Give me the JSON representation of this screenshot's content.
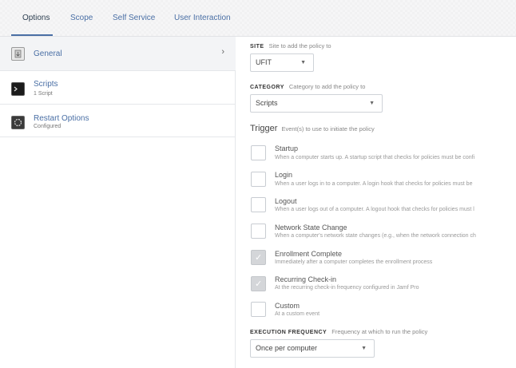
{
  "tabs": [
    {
      "label": "Options"
    },
    {
      "label": "Scope"
    },
    {
      "label": "Self Service"
    },
    {
      "label": "User Interaction"
    }
  ],
  "sidebar": {
    "items": [
      {
        "title": "General",
        "subtitle": "",
        "icon": "general-icon"
      },
      {
        "title": "Scripts",
        "subtitle": "1 Script",
        "icon": "terminal-icon"
      },
      {
        "title": "Restart Options",
        "subtitle": "Configured",
        "icon": "restart-icon"
      }
    ]
  },
  "site": {
    "label": "SITE",
    "hint": "Site to add the policy to",
    "value": "UFIT"
  },
  "category": {
    "label": "CATEGORY",
    "hint": "Category to add the policy to",
    "value": "Scripts"
  },
  "trigger": {
    "title": "Trigger",
    "hint": "Event(s) to use to initiate the policy",
    "options": [
      {
        "label": "Startup",
        "desc": "When a computer starts up. A startup script that checks for policies must be confi",
        "checked": false
      },
      {
        "label": "Login",
        "desc": "When a user logs in to a computer. A login hook that checks for policies must be",
        "checked": false
      },
      {
        "label": "Logout",
        "desc": "When a user logs out of a computer. A logout hook that checks for policies must l",
        "checked": false
      },
      {
        "label": "Network State Change",
        "desc": "When a computer's network state changes (e.g., when the network connection ch",
        "checked": false
      },
      {
        "label": "Enrollment Complete",
        "desc": "Immediately after a computer completes the enrollment process",
        "checked": true
      },
      {
        "label": "Recurring Check-in",
        "desc": "At the recurring check-in frequency configured in Jamf Pro",
        "checked": true
      },
      {
        "label": "Custom",
        "desc": "At a custom event",
        "checked": false
      }
    ]
  },
  "execution": {
    "label": "EXECUTION FREQUENCY",
    "hint": "Frequency at which to run the policy",
    "value": "Once per computer"
  },
  "colors": {
    "accent": "#4a6fa5",
    "checked_box": "#d4d6d9"
  }
}
